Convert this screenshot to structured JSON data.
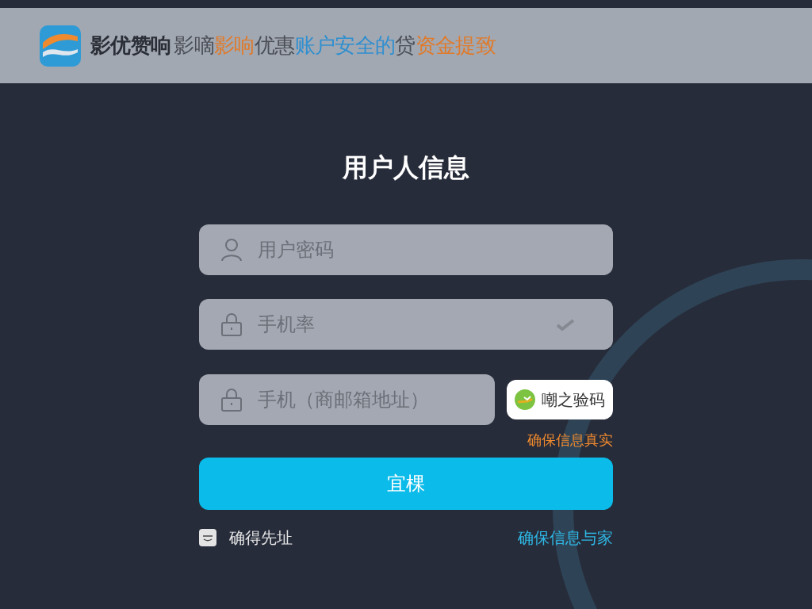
{
  "header": {
    "segments": [
      {
        "text": "影优赞响",
        "color": "#2a2e36"
      },
      {
        "text": "影嘀",
        "color": "#4a4e56"
      },
      {
        "text": "影响",
        "color": "#e07a2a"
      },
      {
        "text": "优惠",
        "color": "#4a4e56"
      },
      {
        "text": "账户安全的",
        "color": "#2f8fd0"
      },
      {
        "text": "贷",
        "color": "#4a4e56"
      },
      {
        "text": "资金提致",
        "color": "#e07a2a"
      }
    ]
  },
  "title": "用户人信息",
  "fields": [
    {
      "kind": "user",
      "placeholder": "用户密码",
      "verified": false
    },
    {
      "kind": "lock",
      "placeholder": "手机率",
      "verified": true
    },
    {
      "kind": "lock",
      "placeholder": "手机（商邮箱地址）",
      "verified": false
    }
  ],
  "code_button": "嘲之验码",
  "hint": "确保信息真实",
  "submit": "宜棵",
  "remember": {
    "label": "确得先址",
    "checked": true
  },
  "link": "确保信息与家"
}
